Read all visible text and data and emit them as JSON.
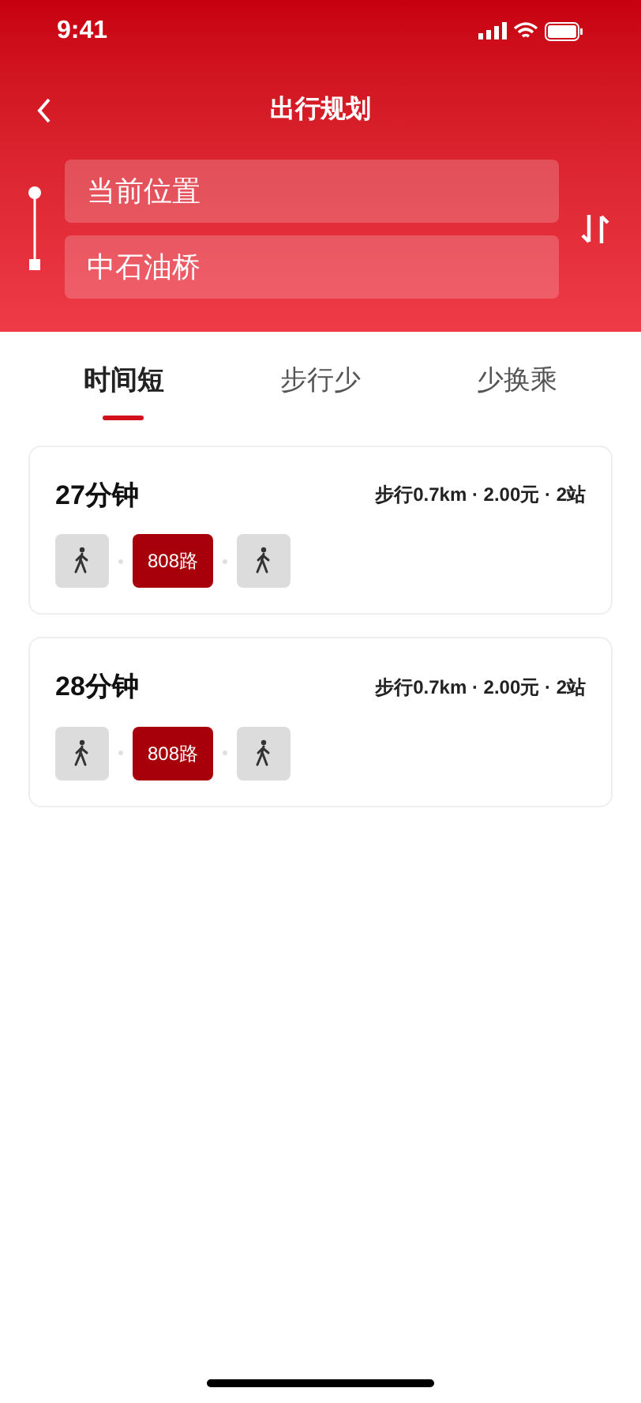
{
  "status_bar": {
    "time": "9:41"
  },
  "header": {
    "title": "出行规划",
    "origin": {
      "value": "当前位置"
    },
    "destination": {
      "value": "中石油桥"
    }
  },
  "tabs": [
    {
      "label": "时间短",
      "selected": true
    },
    {
      "label": "步行少",
      "selected": false
    },
    {
      "label": "少换乘",
      "selected": false
    }
  ],
  "routes": [
    {
      "duration": "27分钟",
      "summary": "步行0.7km · 2.00元 · 2站",
      "segments": [
        {
          "kind": "walk"
        },
        {
          "kind": "bus",
          "label": "808路"
        },
        {
          "kind": "walk"
        }
      ]
    },
    {
      "duration": "28分钟",
      "summary": "步行0.7km · 2.00元 · 2站",
      "segments": [
        {
          "kind": "walk"
        },
        {
          "kind": "bus",
          "label": "808路"
        },
        {
          "kind": "walk"
        }
      ]
    }
  ]
}
